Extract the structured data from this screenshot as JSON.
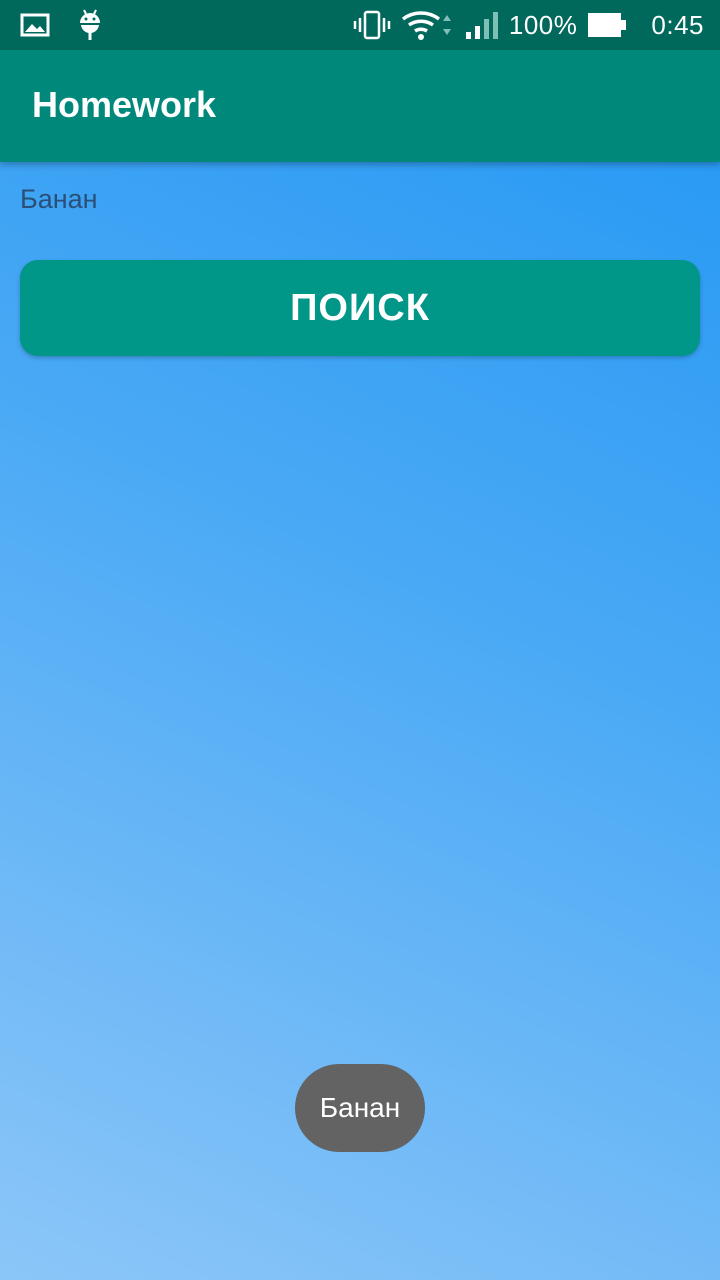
{
  "status_bar": {
    "left_icons": [
      "image-icon",
      "android-icon"
    ],
    "right_icons": [
      "vibrate-icon",
      "wifi-icon",
      "signal-icon",
      "battery-icon"
    ],
    "battery_percent": "100%",
    "time": "0:45"
  },
  "app_bar": {
    "title": "Homework",
    "color": "#00897B"
  },
  "content": {
    "result_text": "Банан",
    "search_button_label": "ПОИСК",
    "button_color": "#009688"
  },
  "toast": {
    "message": "Банан"
  }
}
